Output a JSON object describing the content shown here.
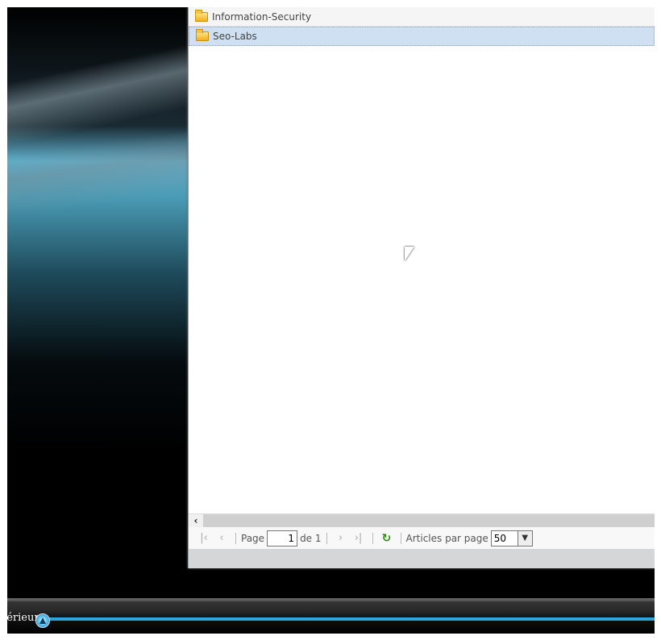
{
  "tree": {
    "items": [
      {
        "label": "Information-Security",
        "icon": "folder-icon",
        "selected": false
      },
      {
        "label": "Seo-Labs",
        "icon": "folder-icon",
        "selected": true
      }
    ]
  },
  "pager": {
    "page_label": "Page",
    "page_value": "1",
    "of_label": "de 1",
    "per_page_label": "Articles par page",
    "per_page_value": "50"
  },
  "taskbar": {
    "label": "térieur"
  },
  "colors": {
    "selected_row": "#cfe0f3",
    "accent": "#2aa6dc",
    "refresh": "#2e8b14"
  }
}
